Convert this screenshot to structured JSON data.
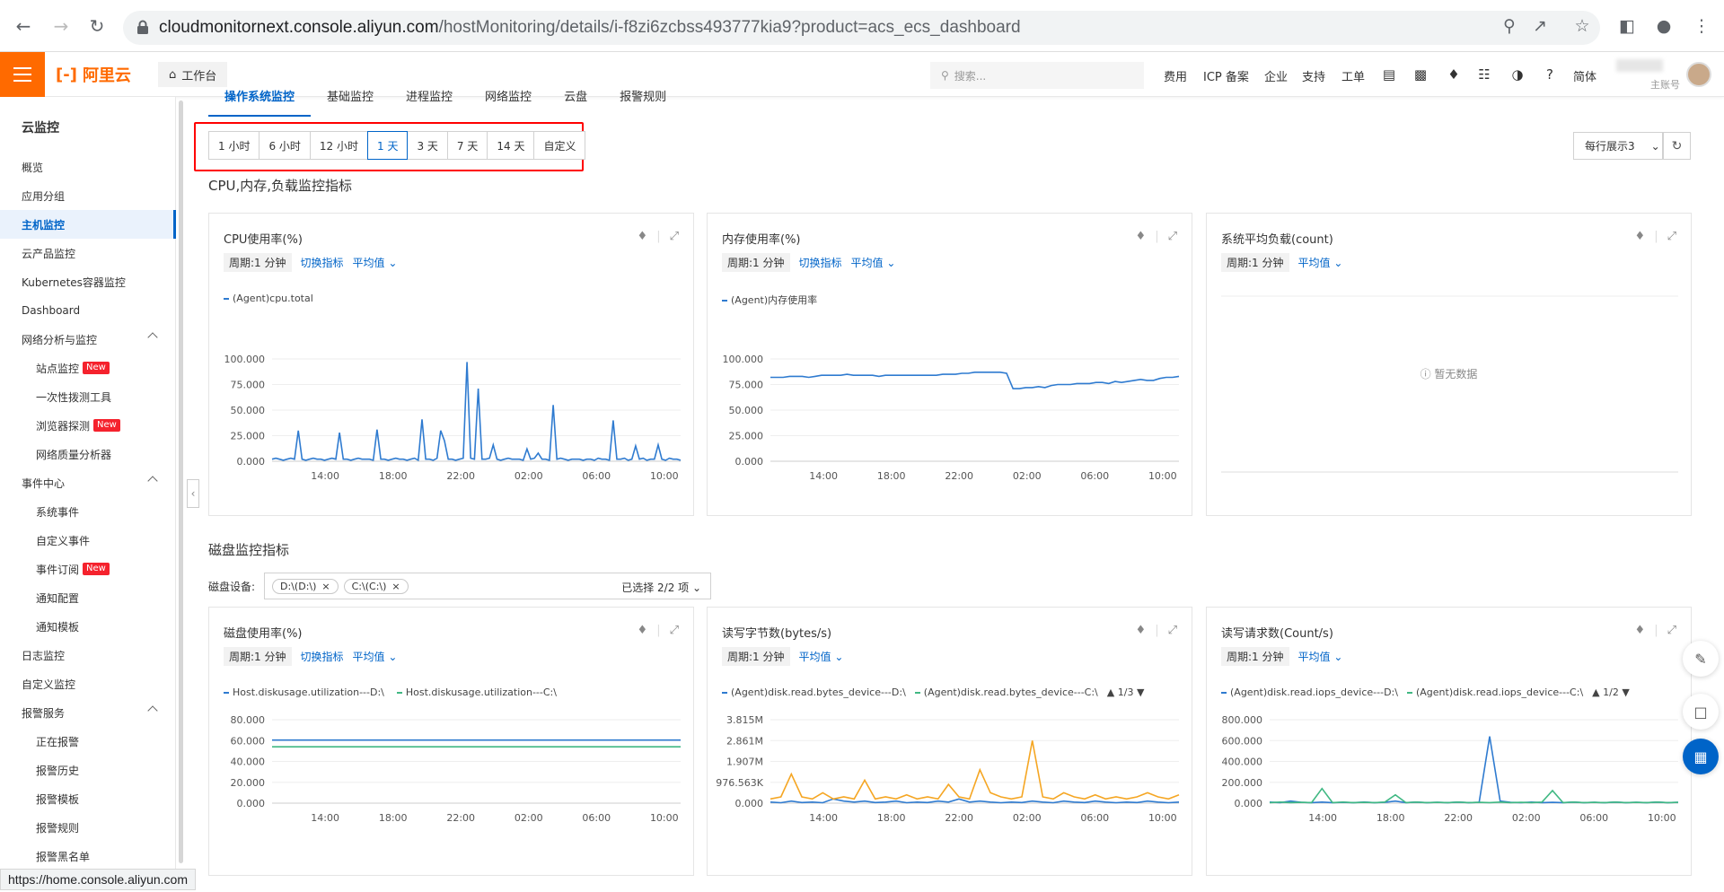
{
  "browser": {
    "url_host": "cloudmonitornext.console.aliyun.com",
    "url_path": "/hostMonitoring/details/i-f8zi6zcbss493777kia9?product=acs_ecs_dashboard",
    "status_url": "https://home.console.aliyun.com"
  },
  "topbar": {
    "logo": "阿里云",
    "workbench": "工作台",
    "search_placeholder": "搜索...",
    "links": [
      "费用",
      "ICP 备案",
      "企业",
      "支持",
      "工单"
    ],
    "lang": "简体",
    "account_sub": "主账号"
  },
  "sidebar": {
    "title": "云监控",
    "items": [
      {
        "label": "概览"
      },
      {
        "label": "应用分组"
      },
      {
        "label": "主机监控"
      },
      {
        "label": "云产品监控"
      },
      {
        "label": "Kubernetes容器监控"
      },
      {
        "label": "Dashboard"
      },
      {
        "label": "网络分析与监控"
      },
      {
        "label": "站点监控",
        "badge": "New"
      },
      {
        "label": "一次性拨测工具"
      },
      {
        "label": "浏览器探测",
        "badge": "New"
      },
      {
        "label": "网络质量分析器"
      },
      {
        "label": "事件中心"
      },
      {
        "label": "系统事件"
      },
      {
        "label": "自定义事件"
      },
      {
        "label": "事件订阅",
        "badge": "New"
      },
      {
        "label": "通知配置"
      },
      {
        "label": "通知模板"
      },
      {
        "label": "日志监控"
      },
      {
        "label": "自定义监控"
      },
      {
        "label": "报警服务"
      },
      {
        "label": "正在报警"
      },
      {
        "label": "报警历史"
      },
      {
        "label": "报警模板"
      },
      {
        "label": "报警规则"
      },
      {
        "label": "报警黑名单"
      }
    ]
  },
  "tabs": [
    "操作系统监控",
    "基础监控",
    "进程监控",
    "网络监控",
    "云盘",
    "报警规则"
  ],
  "time_ranges": [
    "1 小时",
    "6 小时",
    "12 小时",
    "1 天",
    "3 天",
    "7 天",
    "14 天",
    "自定义"
  ],
  "time_active": "1 天",
  "per_row_label": "每行展示3",
  "sections": {
    "cpu_section": "CPU,内存,负载监控指标",
    "disk_section": "磁盘监控指标",
    "disk_device_label": "磁盘设备:",
    "disk_chips": [
      "D:\\(D:\\)",
      "C:\\(C:\\)"
    ],
    "disk_selected": "已选择 2/2 项"
  },
  "cards": {
    "period": "周期:1 分钟",
    "switch": "切换指标",
    "avg": "平均值",
    "cpu": {
      "title": "CPU使用率(%)",
      "legend": [
        "(Agent)cpu.total"
      ]
    },
    "mem": {
      "title": "内存使用率(%)",
      "legend": [
        "(Agent)内存使用率"
      ]
    },
    "load": {
      "title": "系统平均负载(count)",
      "nodata": "暂无数据"
    },
    "disk_usage": {
      "title": "磁盘使用率(%)",
      "legend": [
        "Host.diskusage.utilization---D:\\",
        "Host.diskusage.utilization---C:\\"
      ]
    },
    "rw_bytes": {
      "title": "读写字节数(bytes/s)",
      "legend": [
        "(Agent)disk.read.bytes_device---D:\\",
        "(Agent)disk.read.bytes_device---C:\\"
      ],
      "pager": "1/3"
    },
    "rw_iops": {
      "title": "读写请求数(Count/s)",
      "legend": [
        "(Agent)disk.read.iops_device---D:\\",
        "(Agent)disk.read.iops_device---C:\\"
      ],
      "pager": "1/2"
    }
  },
  "colors": {
    "accent": "#0064c8",
    "brand": "#ff6a00",
    "series_blue": "#2f7bd0",
    "series_green": "#40b883",
    "series_orange": "#f5a623",
    "series_purple": "#7b6fe0"
  },
  "chart_data": [
    {
      "type": "line",
      "title": "CPU使用率(%)",
      "x_ticks": [
        "14:00",
        "18:00",
        "22:00",
        "02:00",
        "06:00",
        "10:00"
      ],
      "y_ticks": [
        "100.000",
        "75.000",
        "50.000",
        "25.000",
        "0.000"
      ],
      "ylim": [
        0,
        100
      ],
      "series": [
        {
          "name": "(Agent)cpu.total",
          "color": "#2f7bd0",
          "values": [
            2,
            3,
            2,
            1,
            2,
            3,
            2,
            30,
            2,
            1,
            2,
            3,
            2,
            2,
            1,
            2,
            3,
            2,
            28,
            2,
            2,
            1,
            2,
            3,
            2,
            2,
            2,
            1,
            31,
            2,
            2,
            1,
            2,
            3,
            2,
            2,
            1,
            2,
            3,
            1,
            41,
            2,
            2,
            1,
            3,
            30,
            20,
            2,
            2,
            1,
            2,
            3,
            97,
            3,
            2,
            71,
            2,
            2,
            3,
            16,
            2,
            1,
            2,
            3,
            2,
            2,
            2,
            1,
            12,
            2,
            3,
            8,
            2,
            2,
            1,
            55,
            2,
            3,
            2,
            1,
            2,
            2,
            2,
            1,
            2,
            2,
            1,
            3,
            2,
            2,
            1,
            40,
            2,
            2,
            3,
            1,
            2,
            15,
            2,
            3,
            1,
            2,
            2,
            16,
            2,
            1,
            3,
            2,
            2,
            1
          ]
        }
      ]
    },
    {
      "type": "line",
      "title": "内存使用率(%)",
      "x_ticks": [
        "14:00",
        "18:00",
        "22:00",
        "02:00",
        "06:00",
        "10:00"
      ],
      "y_ticks": [
        "100.000",
        "75.000",
        "50.000",
        "25.000",
        "0.000"
      ],
      "ylim": [
        0,
        100
      ],
      "series": [
        {
          "name": "(Agent)内存使用率",
          "color": "#2f7bd0",
          "values": [
            82,
            82,
            82,
            83,
            83,
            83,
            82,
            83,
            84,
            84,
            84,
            84,
            85,
            84,
            84,
            84,
            84,
            83,
            84,
            84,
            84,
            84,
            84,
            84,
            84,
            84,
            84,
            85,
            85,
            85,
            86,
            86,
            87,
            87,
            87,
            87,
            87,
            86,
            71,
            71,
            72,
            72,
            73,
            72,
            74,
            75,
            75,
            75,
            76,
            76,
            76,
            77,
            77,
            76,
            78,
            77,
            78,
            79,
            80,
            79,
            79,
            81,
            82,
            82,
            83
          ]
        }
      ]
    },
    {
      "type": "line",
      "title": "系统平均负载(count)",
      "series": []
    },
    {
      "type": "line",
      "title": "磁盘使用率(%)",
      "x_ticks": [
        "14:00",
        "18:00",
        "22:00",
        "02:00",
        "06:00",
        "10:00"
      ],
      "y_ticks": [
        "80.000",
        "60.000",
        "40.000",
        "20.000",
        "0.000"
      ],
      "ylim": [
        0,
        80
      ],
      "series": [
        {
          "name": "Host.diskusage.utilization---D:\\",
          "color": "#2f7bd0",
          "values": [
            60.5,
            60.5
          ]
        },
        {
          "name": "Host.diskusage.utilization---C:\\",
          "color": "#40b883",
          "values": [
            54,
            54
          ]
        }
      ]
    },
    {
      "type": "line",
      "title": "读写字节数(bytes/s)",
      "x_ticks": [
        "14:00",
        "18:00",
        "22:00",
        "02:00",
        "06:00",
        "10:00"
      ],
      "y_ticks": [
        "3.815M",
        "2.861M",
        "1.907M",
        "976.563K",
        "0.000"
      ],
      "ylim": [
        0,
        4000000
      ],
      "series": [
        {
          "name": "(Agent)disk.read.bytes_device---D:\\",
          "color": "#2f7bd0",
          "values": [
            0.05,
            0.02,
            0.1,
            0.03,
            0.05,
            0.02,
            0.2,
            0.1,
            0.05,
            0.1,
            0.03,
            0.05,
            0.1,
            0.02,
            0.05,
            0.03,
            0.1,
            0.05,
            0.2,
            0.05,
            0.1,
            0.05,
            0.02,
            0.05,
            0.03,
            0.1,
            0.05,
            0.02,
            0.1,
            0.05,
            0.03,
            0.1,
            0.05,
            0.02,
            0.05,
            0.03,
            0.1,
            0.05,
            0.02,
            0.05
          ]
        },
        {
          "name": "(Agent)disk.read.bytes_device---C:\\",
          "color": "#f5a623",
          "values": [
            0.2,
            0.3,
            1.4,
            0.3,
            0.2,
            0.5,
            0.2,
            0.3,
            0.2,
            1.1,
            0.2,
            0.3,
            0.2,
            0.4,
            0.2,
            0.3,
            0.2,
            0.9,
            0.3,
            0.2,
            1.6,
            0.5,
            0.3,
            0.2,
            0.3,
            3.0,
            0.3,
            0.2,
            0.5,
            0.3,
            0.2,
            0.4,
            0.2,
            0.3,
            0.2,
            0.3,
            0.5,
            0.3,
            0.2,
            0.4
          ]
        }
      ]
    },
    {
      "type": "line",
      "title": "读写请求数(Count/s)",
      "x_ticks": [
        "14:00",
        "18:00",
        "22:00",
        "02:00",
        "06:00",
        "10:00"
      ],
      "y_ticks": [
        "800.000",
        "600.000",
        "400.000",
        "200.000",
        "0.000"
      ],
      "ylim": [
        0,
        800
      ],
      "series": [
        {
          "name": "(Agent)disk.read.iops_device---D:\\",
          "color": "#2f7bd0",
          "values": [
            10,
            5,
            20,
            8,
            5,
            10,
            5,
            8,
            5,
            10,
            5,
            8,
            20,
            5,
            10,
            5,
            8,
            5,
            10,
            5,
            8,
            640,
            20,
            8,
            5,
            10,
            5,
            8,
            5,
            10,
            5,
            8,
            5,
            10,
            5,
            8,
            5,
            10,
            5,
            8
          ]
        },
        {
          "name": "(Agent)disk.read.iops_device---C:\\",
          "color": "#40b883",
          "values": [
            5,
            10,
            5,
            8,
            5,
            140,
            5,
            10,
            5,
            8,
            5,
            10,
            80,
            5,
            10,
            5,
            8,
            5,
            10,
            5,
            8,
            5,
            10,
            5,
            8,
            5,
            10,
            120,
            5,
            10,
            5,
            8,
            5,
            10,
            5,
            8,
            5,
            10,
            5,
            8
          ]
        }
      ]
    }
  ]
}
